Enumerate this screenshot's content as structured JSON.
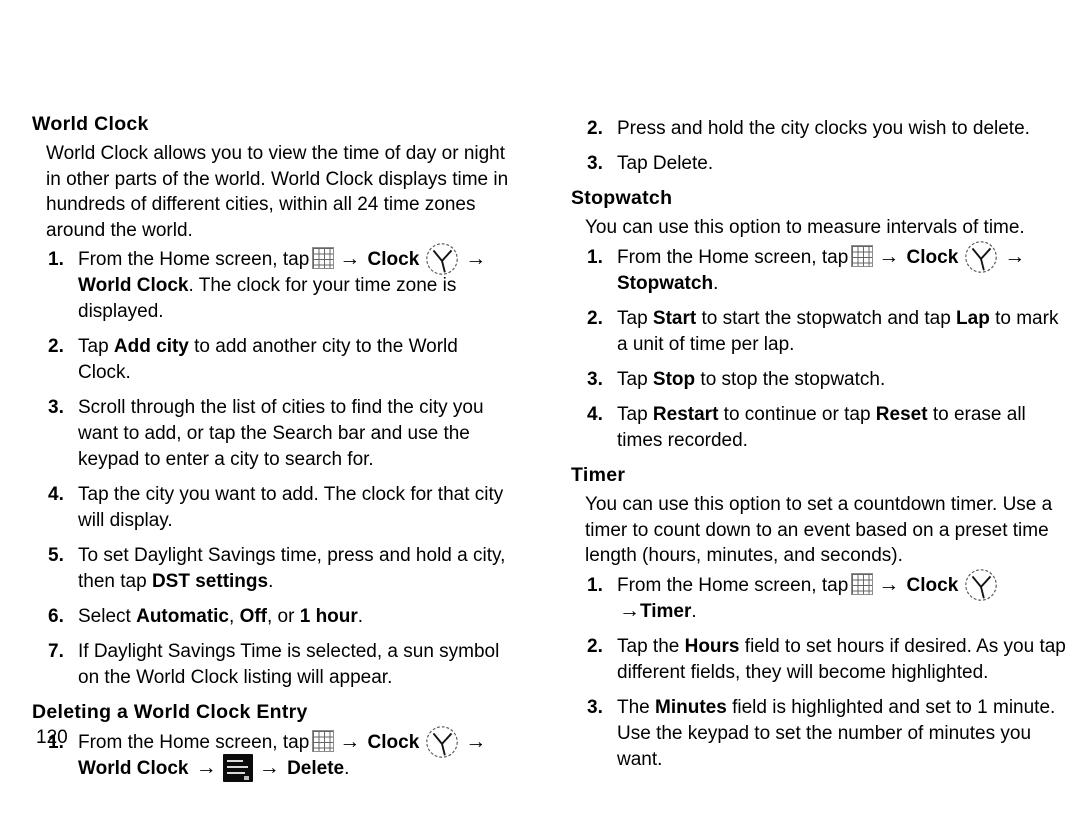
{
  "page": {
    "number": "120"
  },
  "icons": {
    "apps_grid": "apps-grid-icon",
    "clock": "clock-icon",
    "menu": "menu-icon",
    "arrow": "→"
  },
  "left_column": {
    "section1": {
      "heading": "World Clock",
      "intro": "World Clock allows you to view the time of day or night in other parts of the world. World Clock displays time in hundreds of different cities, within all 24 time zones around the world.",
      "steps": [
        {
          "num": "1.",
          "prefix": "From the Home screen, tap",
          "mid": "Clock",
          "bold_after": "World Clock",
          "suffix": ". The clock for your time zone is displayed."
        },
        {
          "num": "2.",
          "pre": "Tap ",
          "bold": "Add city",
          "post": " to add another city to the World Clock."
        },
        {
          "num": "3.",
          "pre": "Scroll through the list of cities to find the city you want to add, or tap the Search bar and use the keypad to enter a city to search for.",
          "bold": "",
          "post": ""
        },
        {
          "num": "4.",
          "pre": "Tap the city you want to add. The clock for that city will display.",
          "bold": "",
          "post": ""
        },
        {
          "num": "5.",
          "pre": "To set Daylight Savings time, press and hold a city, then tap ",
          "bold": "DST settings",
          "post": "."
        },
        {
          "num": "6.",
          "pre": "Select ",
          "bold": "Automatic",
          "mid1": ", ",
          "bold2": "Off",
          "mid2": ", or ",
          "bold3": "1 hour",
          "post": "."
        },
        {
          "num": "7.",
          "pre": "If Daylight Savings Time is selected, a sun symbol on the World Clock listing will appear.",
          "bold": "",
          "post": ""
        }
      ]
    },
    "section2": {
      "heading": "Deleting a World Clock Entry",
      "step1": {
        "num": "1.",
        "prefix": "From the Home screen, tap",
        "mid": "Clock",
        "bold_after": "World Clock",
        "end_bold": "Delete",
        "suffix": "."
      }
    }
  },
  "right_column": {
    "delete_steps": [
      {
        "num": "2.",
        "text": "Press and hold the city clocks you wish to delete."
      },
      {
        "num": "3.",
        "text": "Tap Delete."
      }
    ],
    "stopwatch": {
      "heading": "Stopwatch",
      "intro": "You can use this option to measure intervals of time.",
      "step1": {
        "num": "1.",
        "prefix": "From the Home screen, tap",
        "mid": "Clock",
        "bold_after": "Stopwatch",
        "suffix": "."
      },
      "steps": [
        {
          "num": "2.",
          "pre": "Tap ",
          "bold": "Start",
          "mid1": " to start the stopwatch and tap ",
          "bold2": "Lap",
          "post": " to mark a unit of time per lap."
        },
        {
          "num": "3.",
          "pre": "Tap ",
          "bold": "Stop",
          "post": " to stop the stopwatch."
        },
        {
          "num": "4.",
          "pre": "Tap ",
          "bold": "Restart",
          "mid1": " to continue or tap ",
          "bold2": "Reset",
          "post": " to erase all times recorded."
        }
      ]
    },
    "timer": {
      "heading": "Timer",
      "intro": "You can use this option to set a countdown timer. Use a timer to count down to an event based on a preset time length (hours, minutes, and seconds).",
      "step1": {
        "num": "1.",
        "prefix": "From the Home screen, tap",
        "mid": "Clock",
        "end_bold": "Timer",
        "suffix": "."
      },
      "steps": [
        {
          "num": "2.",
          "pre": "Tap the ",
          "bold": "Hours",
          "post": " field to set hours if desired. As you tap different fields, they will become highlighted."
        },
        {
          "num": "3.",
          "pre": "The ",
          "bold": "Minutes",
          "post": " field is highlighted and set to 1 minute. Use the keypad to set the number of minutes you want."
        }
      ]
    }
  }
}
